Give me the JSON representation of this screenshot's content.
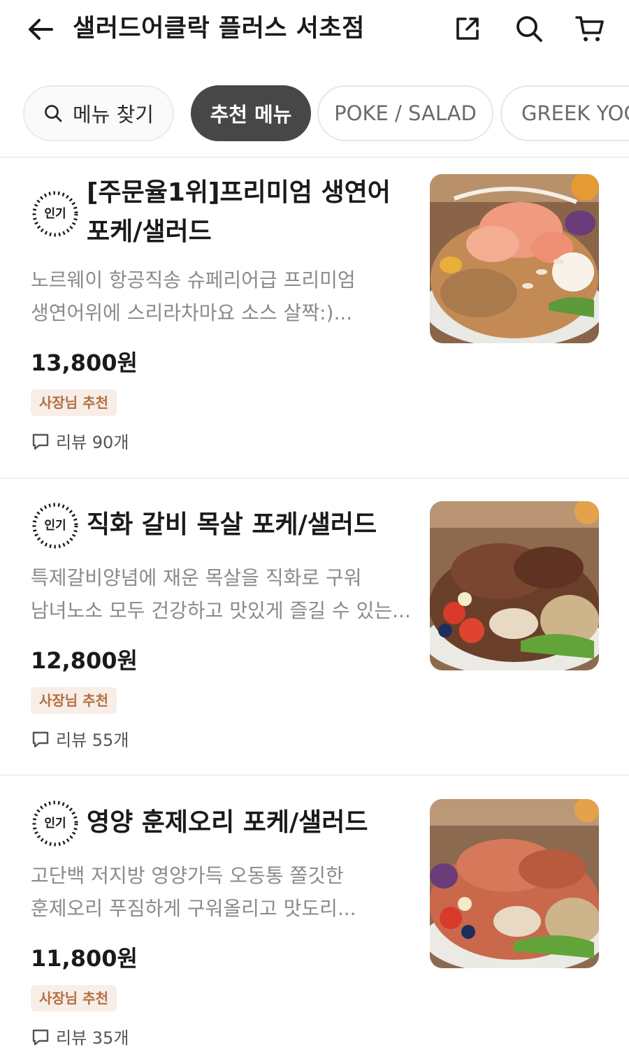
{
  "header": {
    "back_icon": "arrow-left-icon",
    "title": "샐러드어클락 플러스 서초점",
    "share_icon": "share-icon",
    "search_icon": "search-icon",
    "cart_icon": "cart-icon"
  },
  "chips": {
    "search_label": "메뉴 찾기",
    "tabs": [
      {
        "label": "추천 메뉴",
        "active": true
      },
      {
        "label": "POKE / SALAD",
        "active": false
      },
      {
        "label": "GREEK YOG",
        "active": false
      }
    ]
  },
  "menu_items": [
    {
      "popular_badge": "인기",
      "name_line1": "[주문율1위]프리미엄 생연어",
      "name_line2": "포케/샐러드",
      "desc_line1": "노르웨이 항공직송 슈페리어급 프리미엄",
      "desc_line2": "생연어위에 스리라차마요 소스 살짝:)...",
      "price": "13,800원",
      "owner_badge": "사장님 추천",
      "review": "리뷰 90개"
    },
    {
      "popular_badge": "인기",
      "name_line1": "직화 갈비 목살 포케/샐러드",
      "desc_line1": "특제갈비양념에 재운 목살을 직화로 구워",
      "desc_line2": "남녀노소 모두 건강하고 맛있게 즐길 수 있는...",
      "price": "12,800원",
      "owner_badge": "사장님 추천",
      "review": "리뷰 55개"
    },
    {
      "popular_badge": "인기",
      "name_line1": "영양 훈제오리 포케/샐러드",
      "desc_line1": "고단백 저지방 영양가득 오동통 쫄깃한",
      "desc_line2": "훈제오리 푸짐하게 구워올리고 맛도리...",
      "price": "11,800원",
      "owner_badge": "사장님 추천",
      "review": "리뷰 35개"
    }
  ],
  "colors": {
    "active_chip": "#474747",
    "owner_badge_bg": "#f7eee7",
    "owner_badge_text": "#b46f43",
    "desc_text": "#8a8a8a"
  }
}
